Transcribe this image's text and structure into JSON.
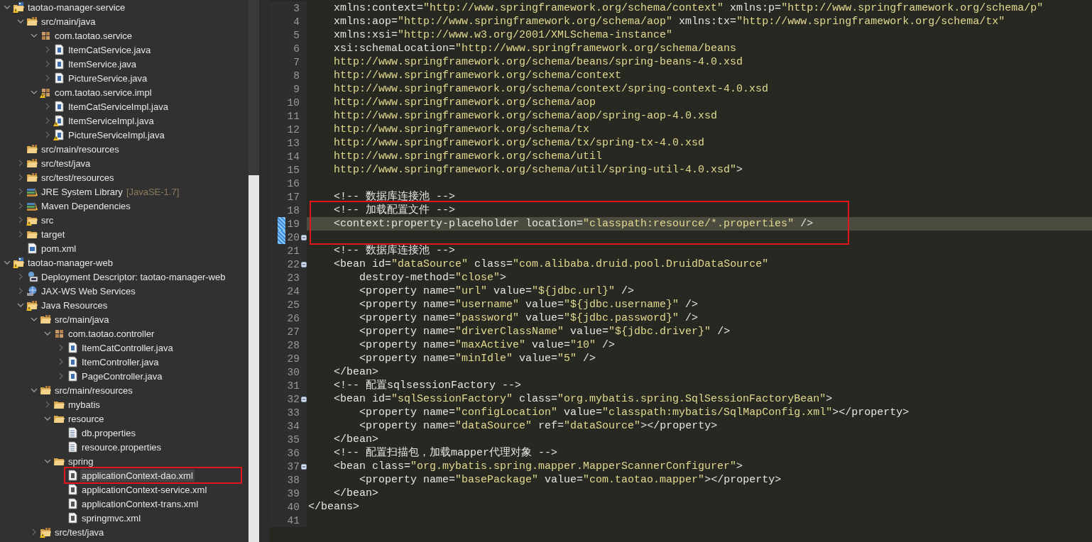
{
  "explorer": {
    "items": [
      {
        "label": "taotao-manager-service",
        "kind": "project",
        "warning": true,
        "expanded": true,
        "selected": false,
        "children": [
          {
            "label": "src/main/java",
            "kind": "source-folder",
            "expanded": true,
            "selected": false,
            "children": [
              {
                "label": "com.taotao.service",
                "kind": "package",
                "expanded": true,
                "selected": false,
                "children": [
                  {
                    "label": "ItemCatService.java",
                    "kind": "java-file",
                    "expanded": false,
                    "selected": false
                  },
                  {
                    "label": "ItemService.java",
                    "kind": "java-file",
                    "expanded": false,
                    "selected": false
                  },
                  {
                    "label": "PictureService.java",
                    "kind": "java-file",
                    "expanded": false,
                    "selected": false
                  }
                ]
              },
              {
                "label": "com.taotao.service.impl",
                "kind": "package",
                "warning": true,
                "expanded": true,
                "selected": false,
                "children": [
                  {
                    "label": "ItemCatServiceImpl.java",
                    "kind": "java-file",
                    "expanded": false,
                    "selected": false
                  },
                  {
                    "label": "ItemServiceImpl.java",
                    "kind": "java-file",
                    "warning": true,
                    "expanded": false,
                    "selected": false
                  },
                  {
                    "label": "PictureServiceImpl.java",
                    "kind": "java-file",
                    "warning": true,
                    "expanded": false,
                    "selected": false
                  }
                ]
              }
            ]
          },
          {
            "label": "src/main/resources",
            "kind": "source-folder",
            "selected": false
          },
          {
            "label": "src/test/java",
            "kind": "source-folder",
            "expanded": false,
            "selected": false
          },
          {
            "label": "src/test/resources",
            "kind": "source-folder",
            "expanded": false,
            "selected": false
          },
          {
            "label": "JRE System Library",
            "decoration": "[JavaSE-1.7]",
            "kind": "library",
            "expanded": false,
            "selected": false
          },
          {
            "label": "Maven Dependencies",
            "kind": "library",
            "expanded": false,
            "selected": false
          },
          {
            "label": "src",
            "kind": "folder",
            "warning": true,
            "expanded": false,
            "selected": false
          },
          {
            "label": "target",
            "kind": "folder",
            "expanded": false,
            "selected": false
          },
          {
            "label": "pom.xml",
            "kind": "pom-file",
            "selected": false
          }
        ]
      },
      {
        "label": "taotao-manager-web",
        "kind": "project",
        "warning": true,
        "expanded": true,
        "selected": false,
        "children": [
          {
            "label": "Deployment Descriptor: taotao-manager-web",
            "kind": "deployment",
            "expanded": false,
            "selected": false
          },
          {
            "label": "JAX-WS Web Services",
            "kind": "web-services",
            "expanded": false,
            "selected": false
          },
          {
            "label": "Java Resources",
            "kind": "source-folder",
            "warning": true,
            "expanded": true,
            "selected": false,
            "children": [
              {
                "label": "src/main/java",
                "kind": "source-folder",
                "expanded": true,
                "selected": false,
                "children": [
                  {
                    "label": "com.taotao.controller",
                    "kind": "package",
                    "expanded": true,
                    "selected": false,
                    "children": [
                      {
                        "label": "ItemCatController.java",
                        "kind": "java-file",
                        "expanded": false,
                        "selected": false
                      },
                      {
                        "label": "ItemController.java",
                        "kind": "java-file",
                        "expanded": false,
                        "selected": false
                      },
                      {
                        "label": "PageController.java",
                        "kind": "java-file",
                        "expanded": false,
                        "selected": false
                      }
                    ]
                  }
                ]
              },
              {
                "label": "src/main/resources",
                "kind": "source-folder",
                "expanded": true,
                "selected": false,
                "children": [
                  {
                    "label": "mybatis",
                    "kind": "folder",
                    "expanded": false,
                    "selected": false
                  },
                  {
                    "label": "resource",
                    "kind": "folder",
                    "expanded": true,
                    "selected": false,
                    "children": [
                      {
                        "label": "db.properties",
                        "kind": "properties-file",
                        "selected": false
                      },
                      {
                        "label": "resource.properties",
                        "kind": "properties-file",
                        "selected": false
                      }
                    ]
                  },
                  {
                    "label": "spring",
                    "kind": "folder",
                    "expanded": true,
                    "selected": false,
                    "children": [
                      {
                        "label": "applicationContext-dao.xml",
                        "kind": "xml-file",
                        "selected": true,
                        "boxed": true
                      },
                      {
                        "label": "applicationContext-service.xml",
                        "kind": "xml-file",
                        "selected": false
                      },
                      {
                        "label": "applicationContext-trans.xml",
                        "kind": "xml-file",
                        "selected": false
                      },
                      {
                        "label": "springmvc.xml",
                        "kind": "xml-file",
                        "selected": false
                      }
                    ]
                  }
                ]
              },
              {
                "label": "src/test/java",
                "kind": "source-folder",
                "warning": true,
                "expanded": false,
                "selected": false
              }
            ]
          }
        ]
      }
    ]
  },
  "editor": {
    "lines": [
      {
        "number": "3",
        "segments": [
          {
            "kind": "markup",
            "text": "    xmlns:context="
          },
          {
            "kind": "string",
            "text": "\"http://www.springframework.org/schema/context\""
          },
          {
            "kind": "markup",
            "text": " xmlns:p="
          },
          {
            "kind": "string",
            "text": "\"http://www.springframework.org/schema/p\""
          }
        ]
      },
      {
        "number": "4",
        "segments": [
          {
            "kind": "markup",
            "text": "    xmlns:aop="
          },
          {
            "kind": "string",
            "text": "\"http://www.springframework.org/schema/aop\""
          },
          {
            "kind": "markup",
            "text": " xmlns:tx="
          },
          {
            "kind": "string",
            "text": "\"http://www.springframework.org/schema/tx\""
          }
        ]
      },
      {
        "number": "5",
        "segments": [
          {
            "kind": "markup",
            "text": "    xmlns:xsi="
          },
          {
            "kind": "string",
            "text": "\"http://www.w3.org/2001/XMLSchema-instance\""
          }
        ]
      },
      {
        "number": "6",
        "segments": [
          {
            "kind": "markup",
            "text": "    xsi:schemaLocation="
          },
          {
            "kind": "string",
            "text": "\"http://www.springframework.org/schema/beans"
          }
        ]
      },
      {
        "number": "7",
        "segments": [
          {
            "kind": "string",
            "text": "    http://www.springframework.org/schema/beans/spring-beans-4.0.xsd"
          }
        ]
      },
      {
        "number": "8",
        "segments": [
          {
            "kind": "string",
            "text": "    http://www.springframework.org/schema/context"
          }
        ]
      },
      {
        "number": "9",
        "segments": [
          {
            "kind": "string",
            "text": "    http://www.springframework.org/schema/context/spring-context-4.0.xsd"
          }
        ]
      },
      {
        "number": "10",
        "segments": [
          {
            "kind": "string",
            "text": "    http://www.springframework.org/schema/aop"
          }
        ]
      },
      {
        "number": "11",
        "segments": [
          {
            "kind": "string",
            "text": "    http://www.springframework.org/schema/aop/spring-aop-4.0.xsd"
          }
        ]
      },
      {
        "number": "12",
        "segments": [
          {
            "kind": "string",
            "text": "    http://www.springframework.org/schema/tx"
          }
        ]
      },
      {
        "number": "13",
        "segments": [
          {
            "kind": "string",
            "text": "    http://www.springframework.org/schema/tx/spring-tx-4.0.xsd"
          }
        ]
      },
      {
        "number": "14",
        "segments": [
          {
            "kind": "string",
            "text": "    http://www.springframework.org/schema/util"
          }
        ]
      },
      {
        "number": "15",
        "segments": [
          {
            "kind": "string",
            "text": "    http://www.springframework.org/schema/util/spring-util-4.0.xsd\""
          },
          {
            "kind": "markup",
            "text": ">"
          }
        ]
      },
      {
        "number": "16"
      },
      {
        "number": "17",
        "segments": [
          {
            "kind": "markup",
            "text": "    <!-- 数据库连接池 -->"
          }
        ]
      },
      {
        "number": "18",
        "boxed": true,
        "segments": [
          {
            "kind": "markup",
            "text": "    <!-- 加载配置文件 -->"
          }
        ]
      },
      {
        "number": "19",
        "boxed": true,
        "current": true,
        "changed": true,
        "segments": [
          {
            "kind": "markup",
            "text": "    <context:property-placeholder location="
          },
          {
            "kind": "string",
            "text": "\"classpath:resource/*.properties\""
          },
          {
            "kind": "markup",
            "text": " />"
          }
        ]
      },
      {
        "number": "20",
        "boxed": true,
        "changed": true,
        "foldable": true
      },
      {
        "number": "21",
        "segments": [
          {
            "kind": "markup",
            "text": "    <!-- 数据库连接池 -->"
          }
        ]
      },
      {
        "number": "22",
        "foldable": true,
        "segments": [
          {
            "kind": "markup",
            "text": "    <bean id="
          },
          {
            "kind": "string",
            "text": "\"dataSource\""
          },
          {
            "kind": "markup",
            "text": " class="
          },
          {
            "kind": "string",
            "text": "\"com.alibaba.druid.pool.DruidDataSource\""
          }
        ]
      },
      {
        "number": "23",
        "segments": [
          {
            "kind": "markup",
            "text": "        destroy-method="
          },
          {
            "kind": "string",
            "text": "\"close\""
          },
          {
            "kind": "markup",
            "text": ">"
          }
        ]
      },
      {
        "number": "24",
        "segments": [
          {
            "kind": "markup",
            "text": "        <property name="
          },
          {
            "kind": "string",
            "text": "\"url\""
          },
          {
            "kind": "markup",
            "text": " value="
          },
          {
            "kind": "string",
            "text": "\"${jdbc.url}\""
          },
          {
            "kind": "markup",
            "text": " />"
          }
        ]
      },
      {
        "number": "25",
        "segments": [
          {
            "kind": "markup",
            "text": "        <property name="
          },
          {
            "kind": "string",
            "text": "\"username\""
          },
          {
            "kind": "markup",
            "text": " value="
          },
          {
            "kind": "string",
            "text": "\"${jdbc.username}\""
          },
          {
            "kind": "markup",
            "text": " />"
          }
        ]
      },
      {
        "number": "26",
        "segments": [
          {
            "kind": "markup",
            "text": "        <property name="
          },
          {
            "kind": "string",
            "text": "\"password\""
          },
          {
            "kind": "markup",
            "text": " value="
          },
          {
            "kind": "string",
            "text": "\"${jdbc.password}\""
          },
          {
            "kind": "markup",
            "text": " />"
          }
        ]
      },
      {
        "number": "27",
        "segments": [
          {
            "kind": "markup",
            "text": "        <property name="
          },
          {
            "kind": "string",
            "text": "\"driverClassName\""
          },
          {
            "kind": "markup",
            "text": " value="
          },
          {
            "kind": "string",
            "text": "\"${jdbc.driver}\""
          },
          {
            "kind": "markup",
            "text": " />"
          }
        ]
      },
      {
        "number": "28",
        "segments": [
          {
            "kind": "markup",
            "text": "        <property name="
          },
          {
            "kind": "string",
            "text": "\"maxActive\""
          },
          {
            "kind": "markup",
            "text": " value="
          },
          {
            "kind": "string",
            "text": "\"10\""
          },
          {
            "kind": "markup",
            "text": " />"
          }
        ]
      },
      {
        "number": "29",
        "segments": [
          {
            "kind": "markup",
            "text": "        <property name="
          },
          {
            "kind": "string",
            "text": "\"minIdle\""
          },
          {
            "kind": "markup",
            "text": " value="
          },
          {
            "kind": "string",
            "text": "\"5\""
          },
          {
            "kind": "markup",
            "text": " />"
          }
        ]
      },
      {
        "number": "30",
        "segments": [
          {
            "kind": "markup",
            "text": "    </bean>"
          }
        ]
      },
      {
        "number": "31",
        "segments": [
          {
            "kind": "markup",
            "text": "    <!-- 配置sqlsessionFactory -->"
          }
        ]
      },
      {
        "number": "32",
        "foldable": true,
        "segments": [
          {
            "kind": "markup",
            "text": "    <bean id="
          },
          {
            "kind": "string",
            "text": "\"sqlSessionFactory\""
          },
          {
            "kind": "markup",
            "text": " class="
          },
          {
            "kind": "string",
            "text": "\"org.mybatis.spring.SqlSessionFactoryBean\""
          },
          {
            "kind": "markup",
            "text": ">"
          }
        ]
      },
      {
        "number": "33",
        "segments": [
          {
            "kind": "markup",
            "text": "        <property name="
          },
          {
            "kind": "string",
            "text": "\"configLocation\""
          },
          {
            "kind": "markup",
            "text": " value="
          },
          {
            "kind": "string",
            "text": "\"classpath:mybatis/SqlMapConfig.xml\""
          },
          {
            "kind": "markup",
            "text": "></property>"
          }
        ]
      },
      {
        "number": "34",
        "segments": [
          {
            "kind": "markup",
            "text": "        <property name="
          },
          {
            "kind": "string",
            "text": "\"dataSource\""
          },
          {
            "kind": "markup",
            "text": " ref="
          },
          {
            "kind": "string",
            "text": "\"dataSource\""
          },
          {
            "kind": "markup",
            "text": "></property>"
          }
        ]
      },
      {
        "number": "35",
        "segments": [
          {
            "kind": "markup",
            "text": "    </bean>"
          }
        ]
      },
      {
        "number": "36",
        "segments": [
          {
            "kind": "markup",
            "text": "    <!-- 配置扫描包，加载mapper代理对象 -->"
          }
        ]
      },
      {
        "number": "37",
        "foldable": true,
        "segments": [
          {
            "kind": "markup",
            "text": "    <bean class="
          },
          {
            "kind": "string",
            "text": "\"org.mybatis.spring.mapper.MapperScannerConfigurer\""
          },
          {
            "kind": "markup",
            "text": ">"
          }
        ]
      },
      {
        "number": "38",
        "segments": [
          {
            "kind": "markup",
            "text": "        <property name="
          },
          {
            "kind": "string",
            "text": "\"basePackage\""
          },
          {
            "kind": "markup",
            "text": " value="
          },
          {
            "kind": "string",
            "text": "\"com.taotao.mapper\""
          },
          {
            "kind": "markup",
            "text": "></property>"
          }
        ]
      },
      {
        "number": "39",
        "segments": [
          {
            "kind": "markup",
            "text": "    </bean>"
          }
        ]
      },
      {
        "number": "40",
        "segments": [
          {
            "kind": "markup",
            "text": "</beans>"
          }
        ]
      },
      {
        "number": "41"
      }
    ]
  }
}
